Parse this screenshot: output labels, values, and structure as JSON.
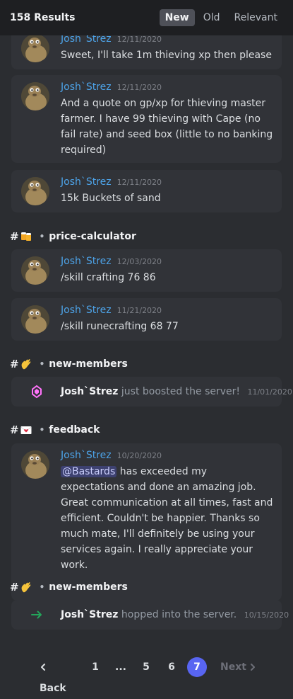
{
  "header": {
    "results_count": "158 Results",
    "sort_tabs": [
      "New",
      "Old",
      "Relevant"
    ],
    "active_sort": "New"
  },
  "messages": [
    {
      "author": "Josh`Strez",
      "timestamp": "12/11/2020",
      "text": "Sweet, I'll take 1m thieving xp then please"
    },
    {
      "author": "Josh`Strez",
      "timestamp": "12/11/2020",
      "text": "And a quote on gp/xp for thieving master farmer. I have 99 thieving with Cape (no fail rate) and seed box (little to no banking required)"
    },
    {
      "author": "Josh`Strez",
      "timestamp": "12/11/2020",
      "text": "15k Buckets of sand"
    },
    {
      "author": "Josh`Strez",
      "timestamp": "12/03/2020",
      "text": "/skill crafting 76 86"
    },
    {
      "author": "Josh`Strez",
      "timestamp": "11/21/2020",
      "text": "/skill runecrafting 68 77"
    },
    {
      "author": "Josh`Strez",
      "timestamp": "10/20/2020",
      "mention": "@Bastards",
      "text": " has exceeded my expectations and done an amazing job. Great communication at all times, fast and efficient. Couldn't be happier. Thanks so much mate, I'll definitely be using your services again. I really appreciate your work."
    }
  ],
  "channels": {
    "price_calculator": {
      "hash": "#",
      "separator": "•",
      "name": "price-calculator",
      "emoji": "beer-mugs-icon"
    },
    "new_members_1": {
      "hash": "#",
      "separator": "•",
      "name": "new-members",
      "emoji": "waving-hand-icon"
    },
    "feedback": {
      "hash": "#",
      "separator": "•",
      "name": "feedback",
      "emoji": "envelope-heart-icon"
    },
    "new_members_2": {
      "hash": "#",
      "separator": "•",
      "name": "new-members",
      "emoji": "waving-hand-icon"
    }
  },
  "system_messages": [
    {
      "author": "Josh`Strez",
      "action": "just boosted the server!",
      "timestamp": "11/01/2020",
      "icon": "nitro-boost-icon"
    },
    {
      "author": "Josh`Strez",
      "action": "hopped into the server.",
      "timestamp": "10/15/2020",
      "icon": "join-arrow-icon"
    }
  ],
  "pagination": {
    "back_label": "Back",
    "next_label": "Next",
    "pages": [
      "1",
      "...",
      "5",
      "6",
      "7"
    ],
    "current": "7"
  },
  "colors": {
    "background": "#2b2d31",
    "header": "#1e1f22",
    "card": "#313338",
    "author": "#4da3e8",
    "accent": "#5865f2",
    "join_arrow": "#23a55a",
    "boost": "#ff73fa"
  }
}
